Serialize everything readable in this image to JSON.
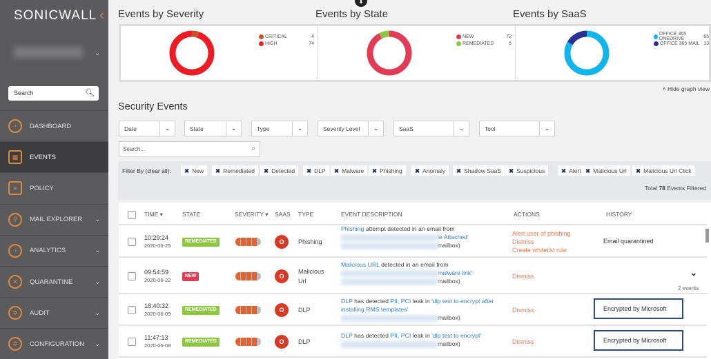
{
  "sidebar": {
    "logo": "SONICWALL",
    "search_placeholder": "Search",
    "items": [
      {
        "label": "DASHBOARD",
        "icon": "gauge-icon"
      },
      {
        "label": "EVENTS",
        "icon": "calendar-icon",
        "active": true
      },
      {
        "label": "POLICY",
        "icon": "clipboard-icon"
      },
      {
        "label": "MAIL EXPLORER",
        "icon": "search-icon"
      },
      {
        "label": "ANALYTICS",
        "icon": "gauge-icon"
      },
      {
        "label": "QUARANTINE",
        "icon": "x-circle-icon"
      },
      {
        "label": "AUDIT",
        "icon": "gear-icon"
      },
      {
        "label": "CONFIGURATION",
        "icon": "gear-icon"
      }
    ]
  },
  "charts": {
    "hide_graph_label": "Hide graph view"
  },
  "chart_data": [
    {
      "type": "pie",
      "title": "Events by Severity",
      "labels": [
        "CRITICAL",
        "HIGH"
      ],
      "values": [
        4,
        74
      ],
      "colors": [
        "#c8502a",
        "#ec1c24"
      ]
    },
    {
      "type": "pie",
      "title": "Events by State",
      "labels": [
        "NEW",
        "REMEDIATED"
      ],
      "values": [
        72,
        6
      ],
      "colors": [
        "#e23b55",
        "#8dc63f"
      ]
    },
    {
      "type": "pie",
      "title": "Events by SaaS",
      "labels": [
        "OFFICE 365 ONEDRIVE",
        "OFFICE 365 MAIL"
      ],
      "values": [
        65,
        13
      ],
      "colors": [
        "#11b5ec",
        "#2a3192"
      ]
    }
  ],
  "main": {
    "title": "Security Events",
    "search_placeholder": "Search...",
    "filters": [
      "Date",
      "State",
      "Type",
      "Severity Level",
      "SaaS",
      "Tool"
    ],
    "filter_by_label": "Filter By (clear all):",
    "chips": [
      "New",
      "Remediated",
      "Detected",
      "DLP",
      "Malware",
      "Phishing",
      "Anomaly",
      "Shadow SaaS",
      "Suspicious",
      "Alert",
      "Malicious Url",
      "Malicious Url Click"
    ],
    "total_prefix": "Total",
    "total_count": "78",
    "total_suffix": "Events Filtered"
  },
  "table": {
    "headers": [
      "TIME ▾",
      "STATE",
      "SEVERITY ▾",
      "SAAS",
      "TYPE",
      "EVENT DESCRIPTION",
      "ACTIONS",
      "HISTORY"
    ],
    "rows": [
      {
        "time": "10:29:24",
        "date": "2020-06-25",
        "state": "REMEDIATED",
        "type": "Phishing",
        "desc_link": "Phishing",
        "desc_text": " attempt detected in an email from",
        "desc_link2": "le Attached'",
        "desc_end": "mailbox)",
        "actions": [
          "Alert user of phishing",
          "Dismiss",
          "Create whitelist rule"
        ],
        "history": "Email quarantined"
      },
      {
        "time": "09:54:59",
        "date": "2020-06-22",
        "state": "NEW",
        "type": "Malicious Url",
        "desc_link": "Malicious URL",
        "desc_text": " detected in an email from",
        "desc_link2": "malware link'",
        "desc_end": "mailbox)",
        "actions": [
          "Dismiss"
        ],
        "history": "",
        "events": "2 events"
      },
      {
        "time": "18:40:32",
        "date": "2020-06-09",
        "state": "REMEDIATED",
        "type": "DLP",
        "desc_link": "DLP",
        "desc_text": " has detected ",
        "desc_pii": "PII, PCI",
        "desc_text2": " leak in ",
        "desc_link2": "'dlp test to encrypt after installing RMS templates'",
        "desc_end": "mailbox)",
        "actions": [
          "Dismiss"
        ],
        "history": "Encrypted by Microsoft"
      },
      {
        "time": "11:47:13",
        "date": "2020-06-08",
        "state": "REMEDIATED",
        "type": "DLP",
        "desc_link": "DLP",
        "desc_text": " has detected ",
        "desc_pii": "PII, PCI",
        "desc_text2": " leak in ",
        "desc_link2": "'dlp test to encrypt'",
        "desc_end": "mailbox)",
        "actions": [
          "Dismiss"
        ],
        "history": "Encrypted by Microsoft"
      }
    ]
  },
  "colors": {
    "remediated": "#8dc63f",
    "new": "#e23b55",
    "action": "#f0784a",
    "link": "#2f7fc8"
  }
}
